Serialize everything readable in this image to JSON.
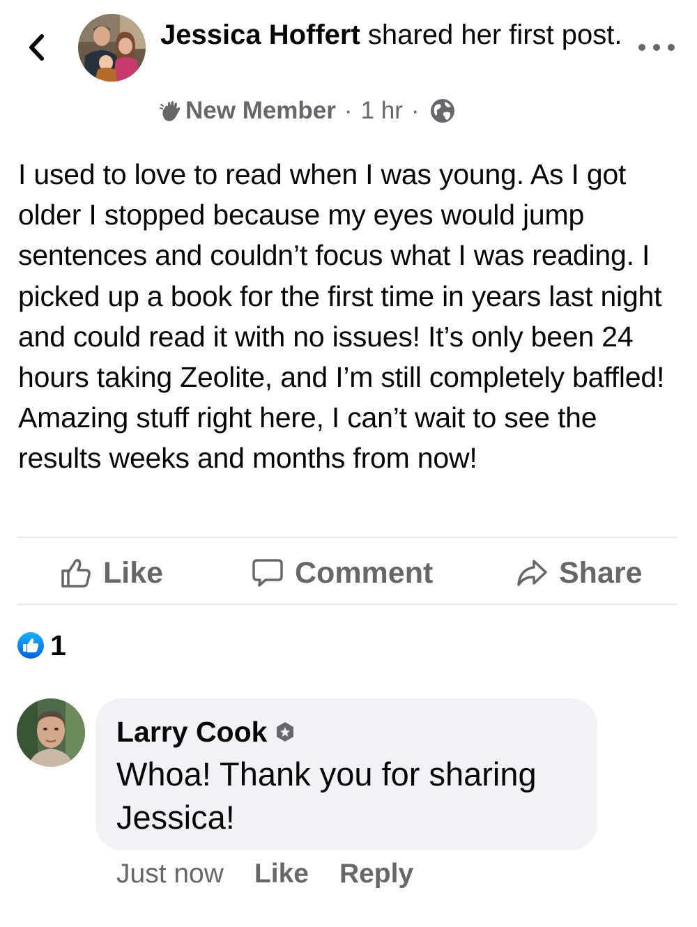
{
  "post": {
    "author_name": "Jessica Hoffert",
    "header_suffix": " shared her first post.",
    "badge_label": "New Member",
    "separator": "·",
    "time": "1 hr",
    "body": "I used to love to read when I was young. As I got older I stopped because my eyes would jump sentences and couldn’t focus what I was reading. I picked up a book for the first time in years last night and could read it with no issues! It’s only been 24 hours taking Zeolite, and I’m still completely baffled! Amazing stuff right here, I can’t wait to see the results weeks and months from now!",
    "privacy_icon": "globe-icon"
  },
  "actions": {
    "like_label": "Like",
    "comment_label": "Comment",
    "share_label": "Share"
  },
  "reactions": {
    "icon": "like-reaction-icon",
    "count": "1"
  },
  "comment": {
    "author": "Larry Cook",
    "text": "Whoa! Thank you for sharing Jessica!",
    "timestamp": "Just now",
    "like_label": "Like",
    "reply_label": "Reply"
  },
  "colors": {
    "text_primary": "#050505",
    "text_secondary": "#65676b",
    "divider": "#e4e6eb",
    "comment_bubble": "#f0f2f5",
    "reaction_blue": "#1877f2"
  }
}
